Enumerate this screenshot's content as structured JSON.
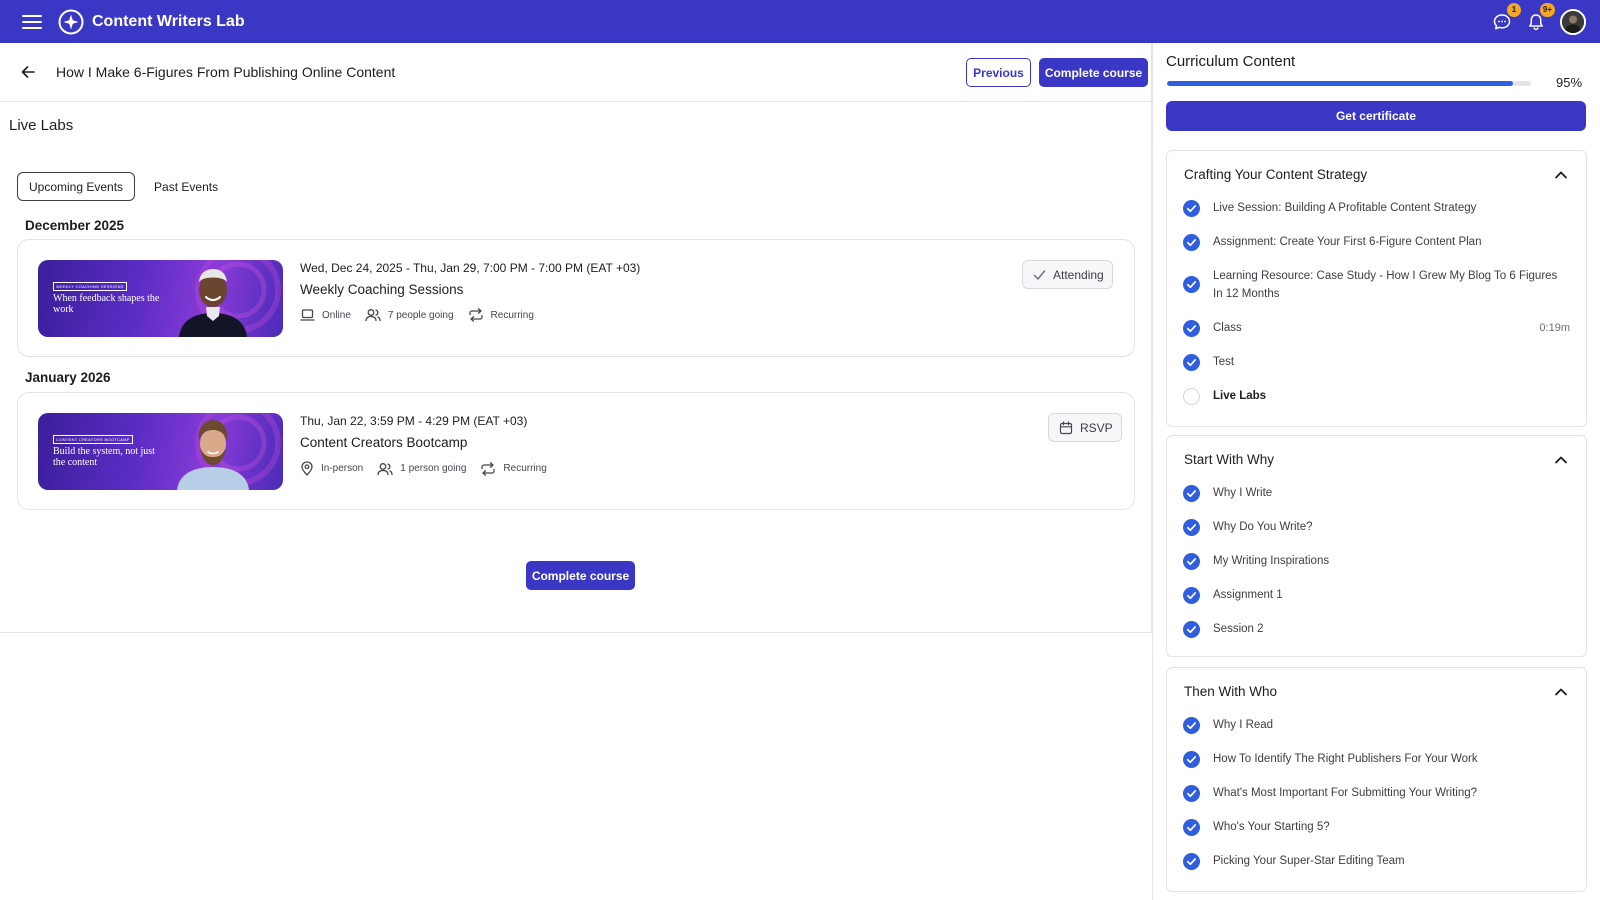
{
  "app": {
    "name": "Content Writers Lab",
    "notifications": {
      "messages_badge": "1",
      "alerts_badge": "9+"
    }
  },
  "header": {
    "course_title": "How I Make 6-Figures From Publishing Online Content",
    "previous_label": "Previous",
    "complete_label": "Complete course"
  },
  "main": {
    "section_title": "Live Labs",
    "tabs": [
      {
        "label": "Upcoming Events",
        "active": true
      },
      {
        "label": "Past Events",
        "active": false
      }
    ],
    "groups": [
      {
        "month": "December 2025",
        "event": {
          "thumb_tag": "WEEKLY COACHING SESSIONS",
          "thumb_text": "When feedback shapes the work",
          "date": "Wed, Dec 24, 2025 - Thu, Jan 29, 7:00 PM - 7:00 PM (EAT +03)",
          "name": "Weekly Coaching Sessions",
          "location": "Online",
          "going": "7 people going",
          "recurrence": "Recurring",
          "action_label": "Attending"
        }
      },
      {
        "month": "January 2026",
        "event": {
          "thumb_tag": "CONTENT CREATORS BOOTCAMP",
          "thumb_text": "Build the system, not just the content",
          "date": "Thu, Jan 22, 3:59 PM - 4:29 PM (EAT +03)",
          "name": "Content Creators Bootcamp",
          "location": "In-person",
          "going": "1 person going",
          "recurrence": "Recurring",
          "action_label": "RSVP"
        }
      }
    ],
    "complete_bottom_label": "Complete course"
  },
  "sidebar": {
    "title": "Curriculum Content",
    "progress_percent": 95,
    "progress_label": "95%",
    "certificate_label": "Get certificate",
    "modules": [
      {
        "title": "Crafting Your Content Strategy",
        "lessons": [
          {
            "label": "Live Session: Building A Profitable Content Strategy",
            "done": true
          },
          {
            "label": "Assignment: Create Your First 6-Figure Content Plan",
            "done": true
          },
          {
            "label": "Learning Resource: Case Study - How I Grew My Blog To 6 Figures In 12 Months",
            "done": true
          },
          {
            "label": "Class",
            "done": true,
            "duration": "0:19m"
          },
          {
            "label": "Test",
            "done": true
          },
          {
            "label": "Live Labs",
            "done": false,
            "current": true
          }
        ]
      },
      {
        "title": "Start With Why",
        "lessons": [
          {
            "label": "Why I Write",
            "done": true
          },
          {
            "label": "Why Do You Write?",
            "done": true
          },
          {
            "label": "My Writing Inspirations",
            "done": true
          },
          {
            "label": "Assignment 1",
            "done": true
          },
          {
            "label": "Session 2",
            "done": true
          }
        ]
      },
      {
        "title": "Then With Who",
        "lessons": [
          {
            "label": "Why I Read",
            "done": true
          },
          {
            "label": "How To Identify The Right Publishers For Your Work",
            "done": true
          },
          {
            "label": "What's Most Important For Submitting Your Writing?",
            "done": true
          },
          {
            "label": "Who's Your Starting 5?",
            "done": true
          },
          {
            "label": "Picking Your Super-Star Editing Team",
            "done": true
          }
        ]
      }
    ]
  },
  "colors": {
    "brand": "#3a37c4",
    "progress": "#2f5fe0",
    "check": "#2f5fe0",
    "badge": "#f5a623"
  },
  "icons": {
    "menu": "hamburger-icon",
    "logo": "sparkle-logo-icon",
    "messages": "chat-icon",
    "alerts": "bell-icon",
    "back": "arrow-left-icon",
    "online": "laptop-icon",
    "in_person": "map-pin-icon",
    "people": "users-icon",
    "recurring": "repeat-icon",
    "attending": "checkmark-icon",
    "rsvp": "calendar-icon",
    "collapse": "chevron-up-icon",
    "lesson_done": "check-circle-icon"
  }
}
